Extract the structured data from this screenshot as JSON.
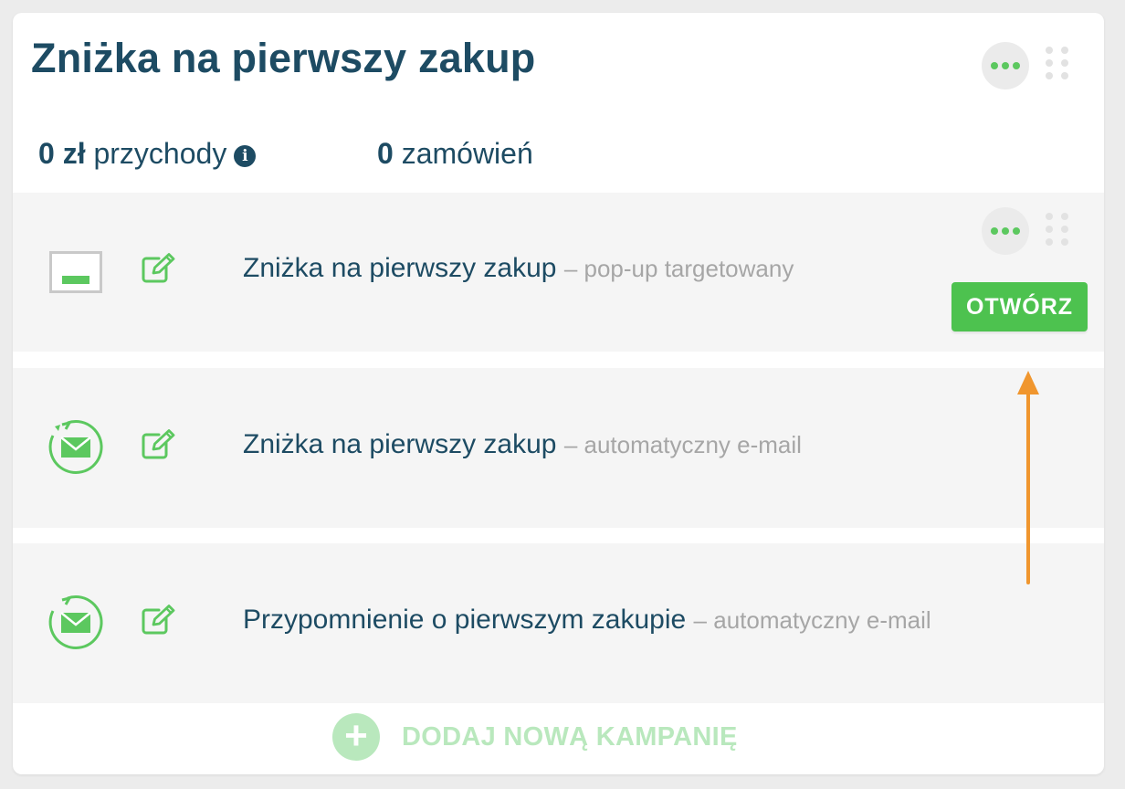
{
  "campaign": {
    "title": "Zniżka na pierwszy zakup",
    "revenue_value": "0 zł",
    "revenue_label": "przychody",
    "orders_value": "0",
    "orders_label": "zamówień"
  },
  "rows": [
    {
      "title": "Zniżka na pierwszy zakup",
      "subtitle": "– pop-up targetowany",
      "type_icon": "popup-window-icon"
    },
    {
      "title": "Zniżka na pierwszy zakup",
      "subtitle": "– automatyczny e-mail",
      "type_icon": "automated-email-icon"
    },
    {
      "title": "Przypomnienie o pierwszym zakupie",
      "subtitle": "– automatyczny e-mail",
      "type_icon": "automated-email-icon"
    }
  ],
  "actions": {
    "open_label": "OTWÓRZ",
    "add_campaign_label": "DODAJ NOWĄ KAMPANIĘ"
  },
  "colors": {
    "accent_green": "#4dc24f",
    "title_navy": "#1d4b63",
    "muted_text": "#a6a6a6",
    "annotation_arrow": "#f0962e"
  }
}
